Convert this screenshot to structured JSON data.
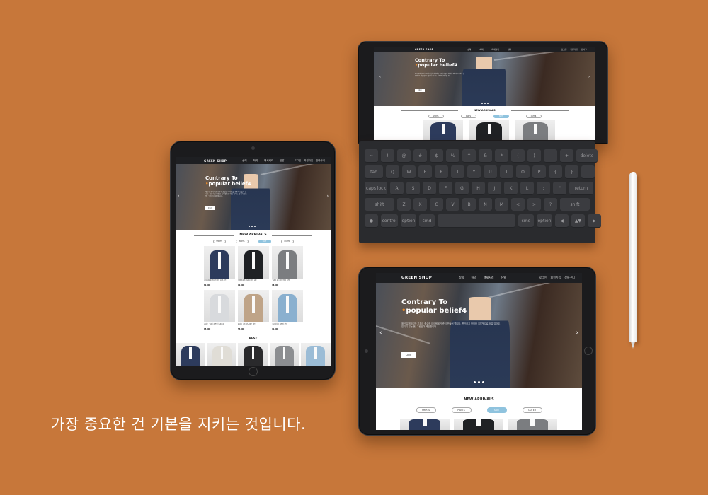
{
  "site": {
    "logo": "GREEN SHOP",
    "nav": [
      "상의",
      "하의",
      "액세서리",
      "신발"
    ],
    "util": [
      "로그인",
      "회원가입",
      "장바구니"
    ],
    "hero_line1": "Contrary To",
    "hero_line2": "popular belief4",
    "hero_desc": "매년 유행하지만 기본에 충실한 아이템을 꾸준히 만들어 냅니다. 편안하고 단정한 실루엣으로 매일 입어도 질리지 않는 옷, 그린샵이 제안합니다.",
    "hero_button": "Click",
    "section_title": "NEW ARRIVALS",
    "tabs": [
      "SHIRTS",
      "PANTS",
      "SUIT",
      "OUTER"
    ],
    "best_title": "BEST",
    "products": [
      {
        "caption": "남성 네이비 슬림핏 정장 자켓 세트",
        "price": "82,000"
      },
      {
        "caption": "블랙 투버튼 클래식 정장 세트",
        "price": "92,000"
      },
      {
        "caption": "그레이 체크 싱글 정장 자켓",
        "price": "78,000"
      },
      {
        "caption": "라이트 그레이 캐주얼 블레이저",
        "price": "65,000"
      },
      {
        "caption": "베이지 코튼 치노 팬츠 세트",
        "price": "54,000"
      },
      {
        "caption": "스카이블루 캐주얼 셋업",
        "price": "71,000"
      }
    ]
  },
  "caption": "가장 중요한 건 기본을 지키는 것입니다.",
  "keyboard": {
    "rows": [
      [
        "~",
        "!",
        "@",
        "#",
        "$",
        "%",
        "^",
        "&",
        "*",
        "(",
        ")",
        "_",
        "+",
        "delete"
      ],
      [
        "tab",
        "Q",
        "W",
        "E",
        "R",
        "T",
        "Y",
        "U",
        "I",
        "O",
        "P",
        "{",
        "}",
        "|"
      ],
      [
        "caps lock",
        "A",
        "S",
        "D",
        "F",
        "G",
        "H",
        "J",
        "K",
        "L",
        ":",
        "\"",
        "return"
      ],
      [
        "shift",
        "Z",
        "X",
        "C",
        "V",
        "B",
        "N",
        "M",
        "<",
        ">",
        "?",
        "shift"
      ],
      [
        "●",
        "control",
        "option",
        "cmd",
        "",
        "cmd",
        "option",
        "◀",
        "▲▼",
        "▶"
      ]
    ]
  },
  "colors": {
    "background": "#c7773a",
    "device": "#1b1b1d",
    "header": "#1e1f22",
    "accent_tab": "#8fc3de",
    "accent_dot": "#e58a2e"
  }
}
